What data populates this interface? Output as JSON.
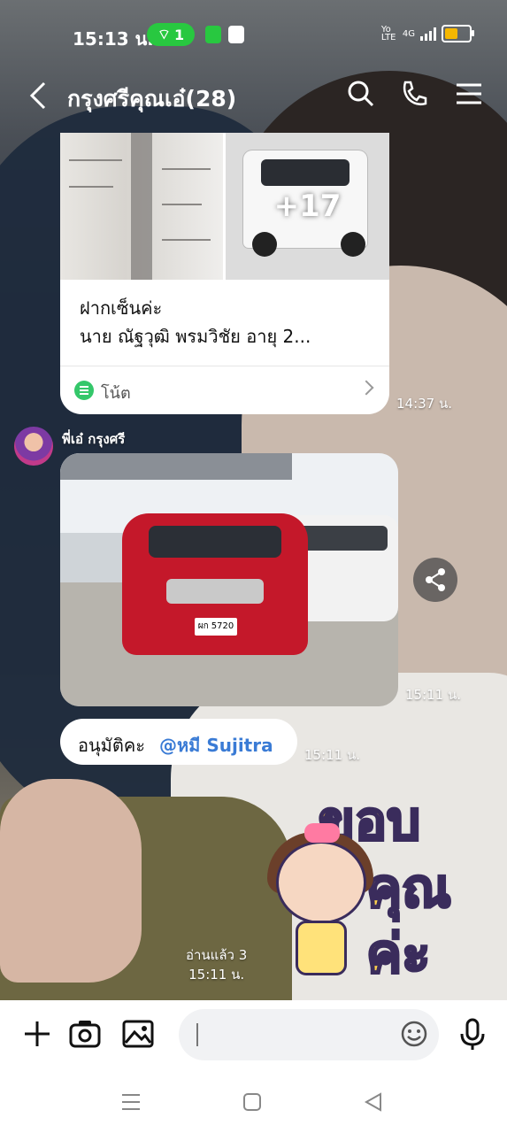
{
  "status_bar": {
    "time": "15:13 น.",
    "hotspot_count": "1",
    "network_label": "4G",
    "volte_label": "Yo LTE"
  },
  "header": {
    "title": "กรุงศรีคุณเอ๋(28)",
    "icons": [
      "back-arrow-icon",
      "search-icon",
      "phone-icon",
      "menu-icon"
    ]
  },
  "messages": {
    "note": {
      "more_photos": "+17",
      "text_line1": "ฝากเซ็นค่ะ",
      "text_line2": "นาย ณัฐวุฒิ  พรมวิชัย อายุ  2...",
      "footer_label": "โน้ต",
      "time": "14:37 น."
    },
    "photo": {
      "sender": "พี่เอ๋ กรุงศรี",
      "plate": "ผก 5720",
      "time": "15:11 น."
    },
    "approval": {
      "text": "อนุมัติคะ",
      "mention": "@หมี Sujitra",
      "time": "15:11 น."
    },
    "sticker": {
      "read_status": "อ่านแล้ว 3",
      "time": "15:11 น."
    }
  },
  "input_bar": {
    "icons": [
      "plus-icon",
      "camera-icon",
      "image-icon",
      "emoji-icon",
      "microphone-icon"
    ]
  },
  "nav_bar": {
    "icons": [
      "recents-icon",
      "home-icon",
      "back-icon"
    ]
  },
  "colors": {
    "accent_green": "#28c840",
    "mention_blue": "#3a7bd5",
    "note_green": "#34c76a"
  }
}
